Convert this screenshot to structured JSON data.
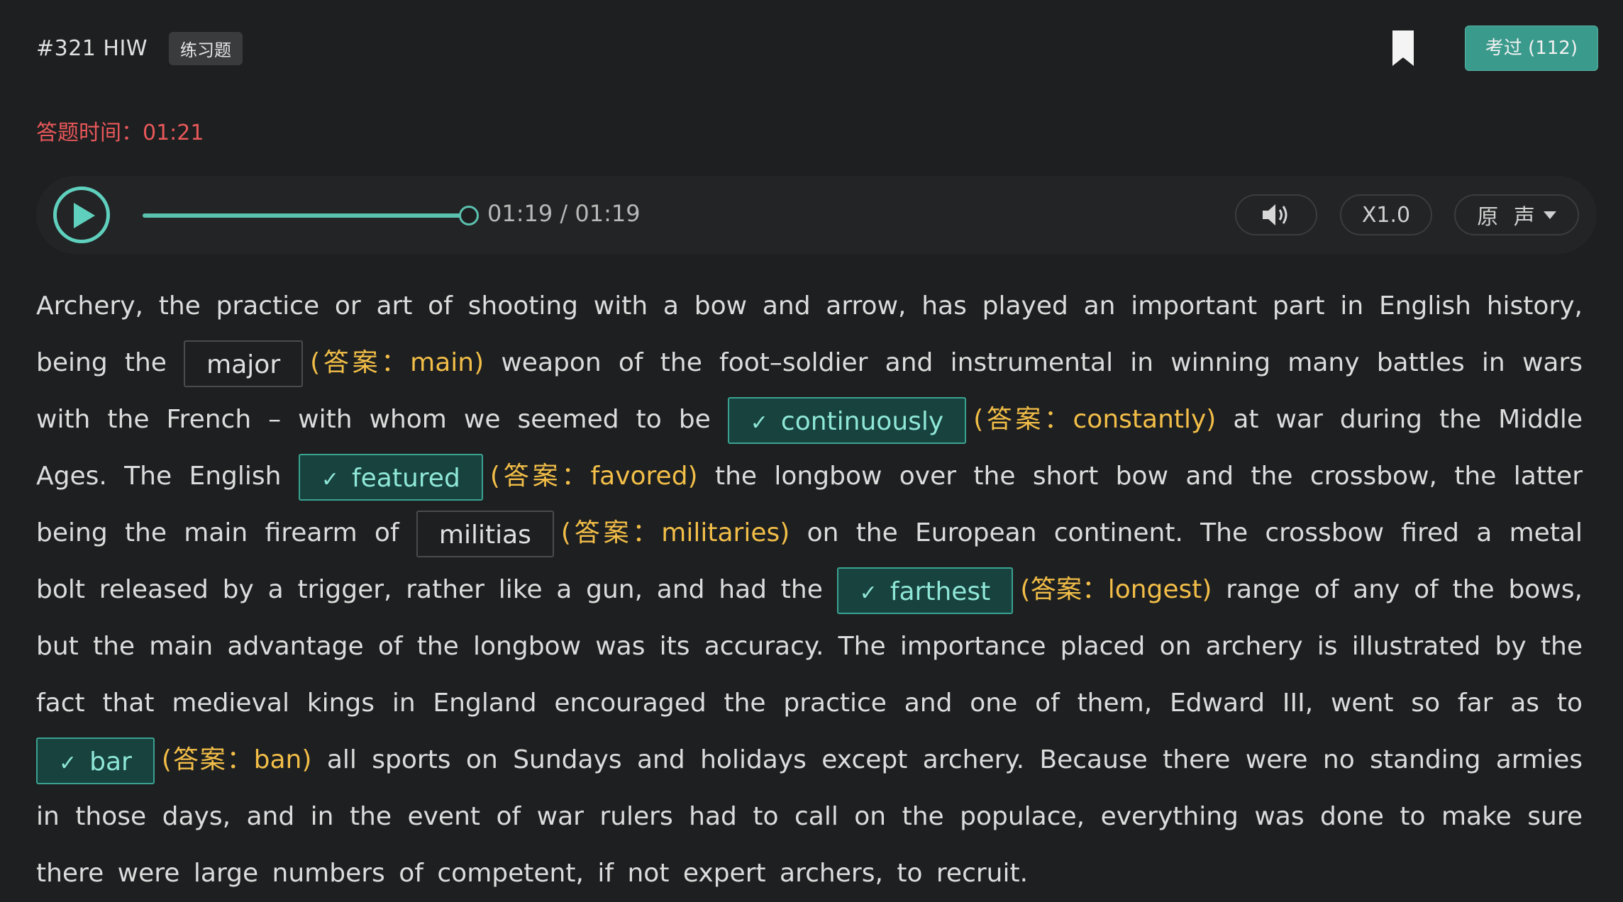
{
  "header": {
    "question_id": "#321 HIW",
    "tag": "练习题",
    "bookmark_icon": "bookmark-icon",
    "taken_button": "考过 (112)"
  },
  "timer": {
    "label": "答题时间：",
    "value": "01:21"
  },
  "player": {
    "play_icon": "play-icon",
    "progress": 1.0,
    "time": "01:19 / 01:19",
    "volume_icon": "volume-icon",
    "speed": "X1.0",
    "voice": "原 声",
    "voice_caret_icon": "caret-down-icon"
  },
  "colors": {
    "accent": "#3a9a8c",
    "answer": "#f2be48",
    "timer": "#e8585a",
    "correct_bg": "#17423e"
  },
  "passage": {
    "t0": "Archery, the practice or art of shooting with a bow and arrow, has played an important part in English history, being the",
    "b1": {
      "text": "major",
      "answer": "(答案：main)",
      "correct": false
    },
    "t1": "weapon of the foot–soldier and instrumental in winning many battles in wars with the French – with whom we seemed to be",
    "b2": {
      "text": "continuously",
      "answer": "(答案：constantly)",
      "correct": true
    },
    "t2": "at war during the Middle Ages. The English",
    "b3": {
      "text": "featured",
      "answer": "(答案：favored)",
      "correct": true
    },
    "t3": "the longbow over the short bow and the crossbow, the latter being the main firearm of",
    "b4": {
      "text": "militias",
      "answer": "(答案：militaries)",
      "correct": false
    },
    "t4": "on the European continent. The crossbow fired a metal bolt released by a trigger, rather like a gun, and had the",
    "b5": {
      "text": "farthest",
      "answer": "(答案：longest)",
      "correct": true
    },
    "t5": "range of any of the bows, but the main advantage of the longbow was its accuracy. The importance placed on archery is illustrated by the fact that medieval kings in England encouraged the practice and one of them, Edward III, went so far as to",
    "b6": {
      "text": "bar",
      "answer": "(答案：ban)",
      "correct": true
    },
    "t6": "all sports on Sundays and holidays except archery. Because there were no standing armies in those days, and in the event of war rulers had to call on the populace, everything was done to make sure there were large numbers of competent, if not expert archers, to recruit."
  }
}
